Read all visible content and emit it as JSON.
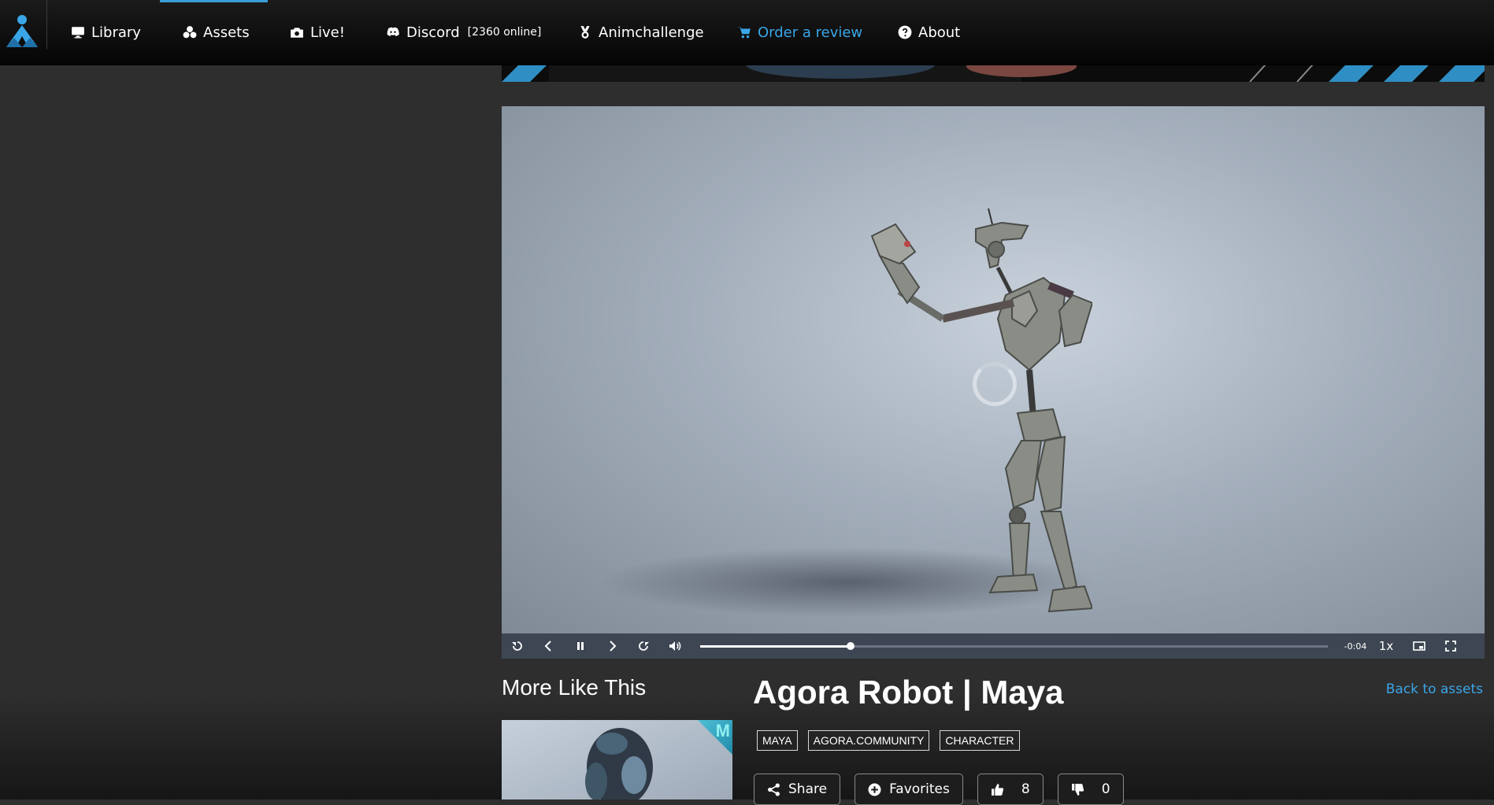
{
  "nav": {
    "items": [
      {
        "label": "Library",
        "icon": "monitor-icon"
      },
      {
        "label": "Assets",
        "icon": "cubes-icon"
      },
      {
        "label": "Live!",
        "icon": "camera-icon"
      },
      {
        "label": "Discord",
        "icon": "discord-icon",
        "online": "[2360 online]"
      },
      {
        "label": "Animchallenge",
        "icon": "medal-icon"
      },
      {
        "label": "Order a review",
        "icon": "cart-icon"
      },
      {
        "label": "About",
        "icon": "question-icon"
      }
    ],
    "accent_color": "#3b9ed8",
    "review_color": "#3aa6e8"
  },
  "player": {
    "time_remaining": "-0:04",
    "speed": "1x",
    "progress_fraction": 0.24
  },
  "more_like_this": {
    "title": "More Like This",
    "thumb_badge": "M"
  },
  "asset": {
    "title": "Agora Robot | Maya",
    "back_link": "Back to assets",
    "tags": [
      "MAYA",
      "AGORA.COMMUNITY",
      "CHARACTER"
    ],
    "actions": {
      "share": "Share",
      "favorites": "Favorites",
      "likes": "8",
      "dislikes": "0"
    }
  }
}
